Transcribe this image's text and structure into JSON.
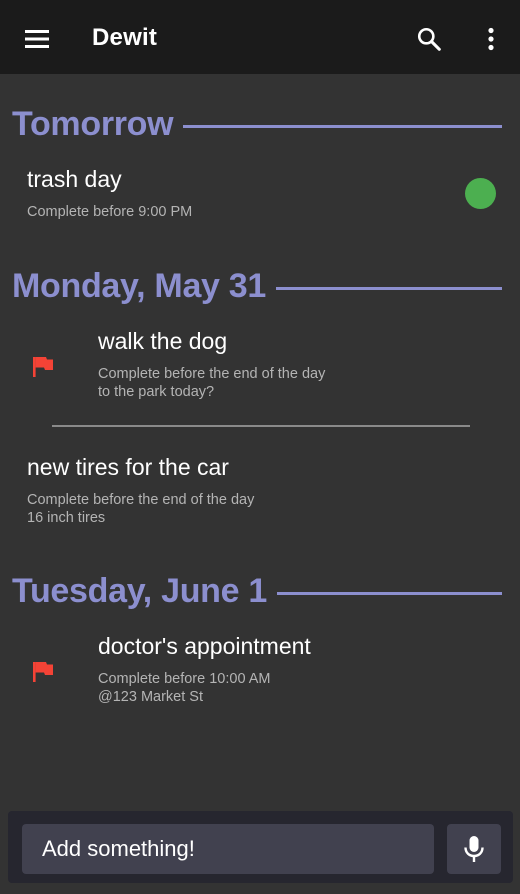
{
  "app_bar": {
    "title": "Dewit",
    "icons": [
      "menu-icon",
      "search-icon",
      "more-vert-icon"
    ]
  },
  "sections": [
    {
      "date": "Tomorrow",
      "tasks": [
        {
          "title": "trash day",
          "due": "Complete before 9:00 PM",
          "note": "",
          "flag": false,
          "status_dot": true
        }
      ]
    },
    {
      "date": "Monday, May 31",
      "tasks": [
        {
          "title": "walk the dog",
          "due": "Complete before the end of the day",
          "note": "to the park today?",
          "flag": true,
          "status_dot": false
        },
        {
          "title": "new tires for the car",
          "due": "Complete before the end of the day",
          "note": "16 inch tires",
          "flag": false,
          "status_dot": false
        }
      ]
    },
    {
      "date": "Tuesday, June 1",
      "tasks": [
        {
          "title": "doctor's appointment",
          "due": "Complete before 10:00 AM",
          "note": "@123 Market St",
          "flag": true,
          "status_dot": false
        }
      ]
    }
  ],
  "composer": {
    "placeholder": "Add something!",
    "mic_icon": "microphone-icon"
  },
  "colors": {
    "app_bar": "#1b1b1b",
    "background": "#333333",
    "section_accent": "#8c8fcf",
    "flag": "#f44336",
    "status_dot": "#4caf50",
    "composer_bar": "#26262f",
    "composer_field": "#41414f"
  }
}
